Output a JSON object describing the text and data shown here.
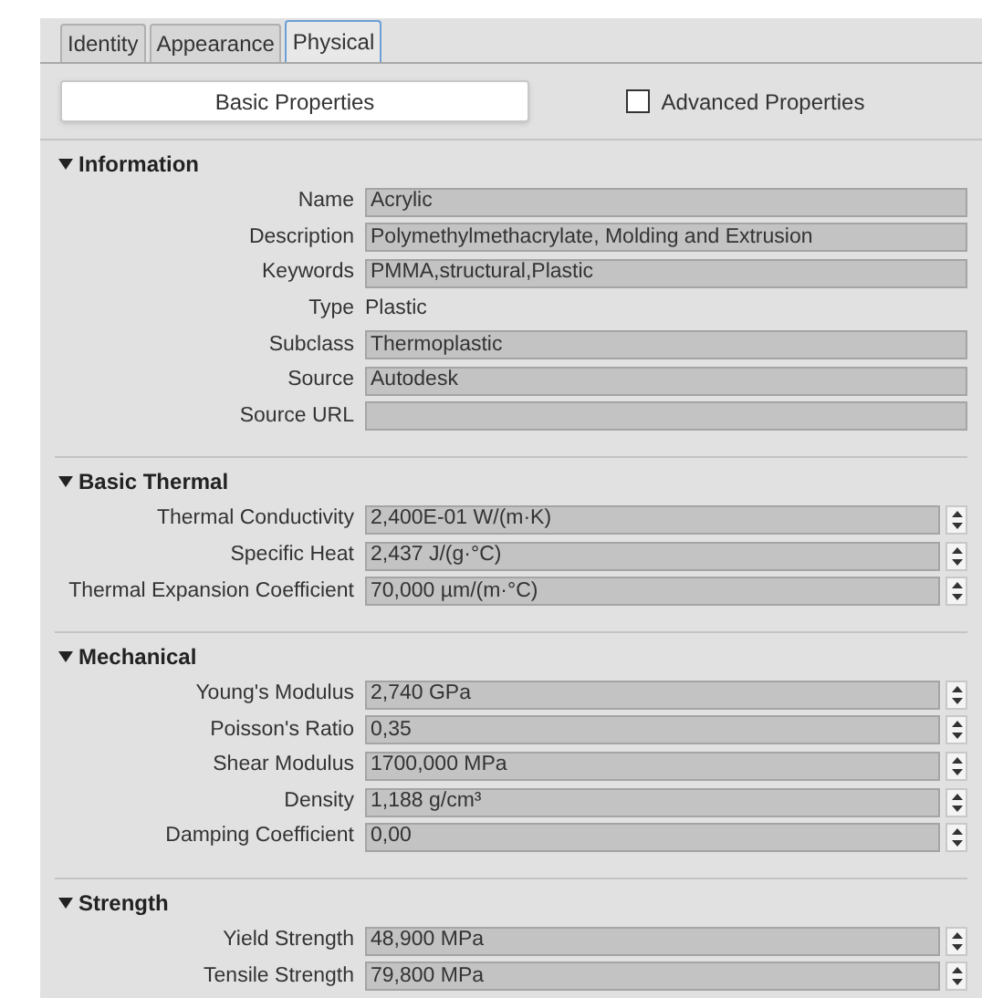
{
  "tabs": [
    {
      "label": "Identity",
      "selected": false
    },
    {
      "label": "Appearance",
      "selected": false
    },
    {
      "label": "Physical",
      "selected": true
    }
  ],
  "basic_button": {
    "label": "Basic Properties",
    "selected": true
  },
  "advanced_checkbox": {
    "label": "Advanced Properties",
    "checked": false
  },
  "sections": [
    {
      "title": "Information",
      "expanded": true,
      "rows": [
        {
          "label": "Name",
          "kind": "text",
          "value": "Acrylic"
        },
        {
          "label": "Description",
          "kind": "text",
          "value": "Polymethylmethacrylate, Molding and Extrusion"
        },
        {
          "label": "Keywords",
          "kind": "text",
          "value": "PMMA,structural,Plastic"
        },
        {
          "label": "Type",
          "kind": "plain",
          "value": "Plastic"
        },
        {
          "label": "Subclass",
          "kind": "text",
          "value": "Thermoplastic"
        },
        {
          "label": "Source",
          "kind": "text",
          "value": "Autodesk"
        },
        {
          "label": "Source URL",
          "kind": "text"
        }
      ]
    },
    {
      "title": "Basic Thermal",
      "expanded": true,
      "rows": [
        {
          "label": "Thermal Conductivity",
          "kind": "spin",
          "value": "2,400E-01 W/(m·K)"
        },
        {
          "label": "Specific Heat",
          "kind": "spin",
          "value": "2,437 J/(g·°C)"
        },
        {
          "label": "Thermal Expansion Coefficient",
          "kind": "spin",
          "value": "70,000 µm/(m·°C)"
        }
      ]
    },
    {
      "title": "Mechanical",
      "expanded": true,
      "rows": [
        {
          "label": "Young's Modulus",
          "kind": "spin",
          "value": "2,740 GPa"
        },
        {
          "label": "Poisson's Ratio",
          "kind": "spin",
          "value": "0,35"
        },
        {
          "label": "Shear Modulus",
          "kind": "spin",
          "value": "1700,000 MPa"
        },
        {
          "label": "Density",
          "kind": "spin",
          "value": "1,188 g/cm³"
        },
        {
          "label": "Damping Coefficient",
          "kind": "spin",
          "value": "0,00"
        }
      ]
    },
    {
      "title": "Strength",
      "expanded": true,
      "rows": [
        {
          "label": "Yield Strength",
          "kind": "spin",
          "value": "48,900 MPa"
        },
        {
          "label": "Tensile Strength",
          "kind": "spin",
          "value": "79,800 MPa"
        }
      ]
    }
  ]
}
